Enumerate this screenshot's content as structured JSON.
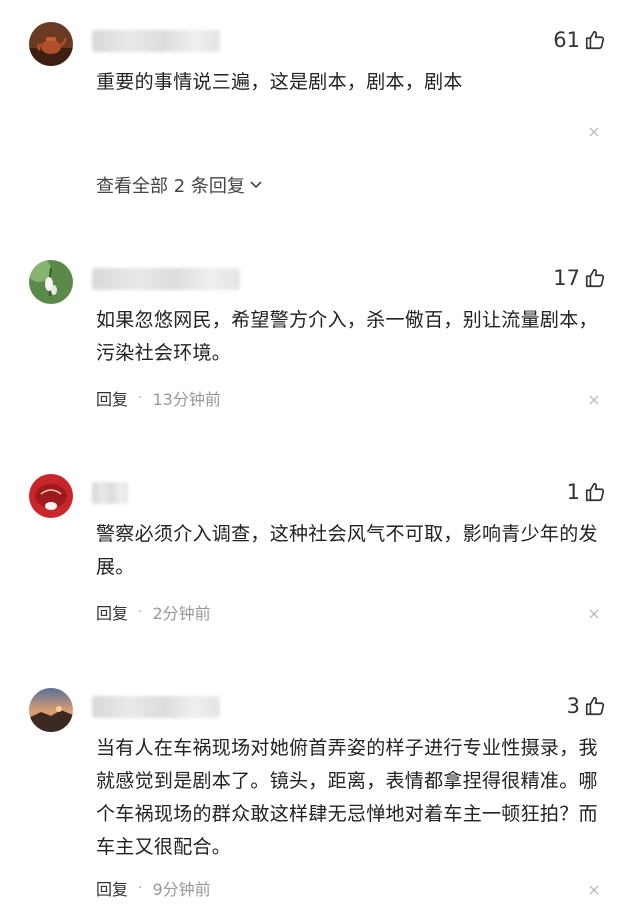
{
  "comments": [
    {
      "likes": "61",
      "text": "重要的事情说三遍，这是剧本，剧本，剧本",
      "view_all": "查看全部 2 条回复",
      "avatar_icon": "teapot-avatar"
    },
    {
      "likes": "17",
      "text": "如果忽悠网民，希望警方介入，杀一儆百，别让流量剧本，污染社会环境。",
      "reply": "回复",
      "separator": "·",
      "time": "13分钟前",
      "avatar_icon": "snowdrop-flower-avatar"
    },
    {
      "likes": "1",
      "text": "警察必须介入调查，这种社会风气不可取，影响青少年的发展。",
      "reply": "回复",
      "separator": "·",
      "time": "2分钟前",
      "avatar_icon": "red-circle-avatar"
    },
    {
      "likes": "3",
      "text": "当有人在车祸现场对她俯首弄姿的样子进行专业性摄录，我就感觉到是剧本了。镜头，距离，表情都拿捏得很精准。哪个车祸现场的群众敢这样肆无忌惮地对着车主一顿狂拍？而车主又很配合。",
      "reply": "回复",
      "separator": "·",
      "time": "9分钟前",
      "avatar_icon": "sunset-landscape-avatar"
    }
  ],
  "colors": {
    "text": "#222222",
    "meta": "#999999",
    "background": "#ffffff"
  }
}
